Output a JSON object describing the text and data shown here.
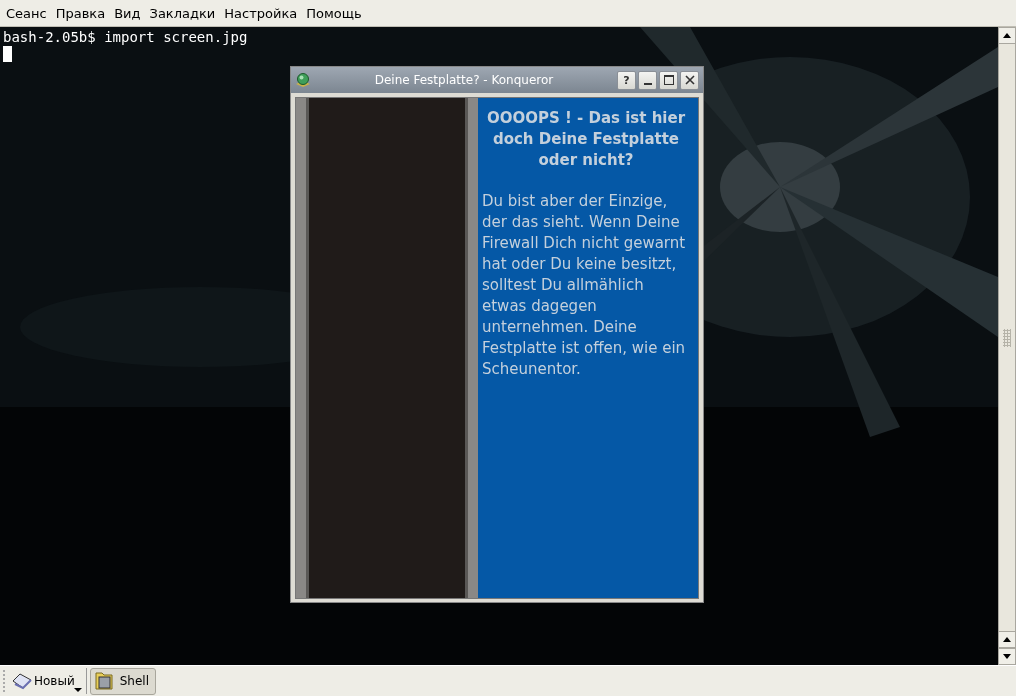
{
  "menu": [
    "Сеанс",
    "Правка",
    "Вид",
    "Закладки",
    "Настройка",
    "Помощь"
  ],
  "terminal": {
    "lines": [
      "bash-2.05b$ import screen.jpg"
    ],
    "cursor": true
  },
  "window": {
    "title": "Deine Festplatte? - Konqueror",
    "buttons": [
      {
        "kind": "help",
        "label": "?"
      },
      {
        "kind": "minimize"
      },
      {
        "kind": "maximize"
      },
      {
        "kind": "close"
      }
    ],
    "heading": "OOOOPS ! - Das ist hier doch Deine Festplatte oder nicht?",
    "body": "Du bist aber der Einzige, der das sieht. Wenn Deine Firewall Dich nicht gewarnt hat oder Du keine besitzt, solltest Du allmählich etwas dagegen unternehmen. Deine Festplatte ist offen, wie ein Scheunentor."
  },
  "taskbar": {
    "new_button": "Новый",
    "tabs": [
      {
        "label": "Shell",
        "selected": true
      }
    ]
  }
}
